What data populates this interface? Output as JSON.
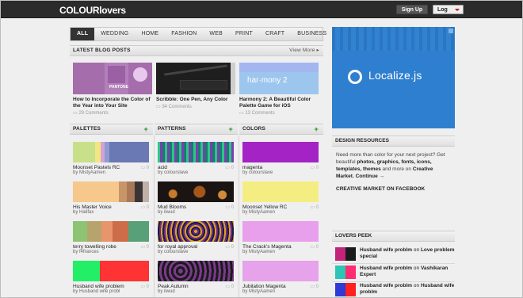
{
  "header": {
    "logo": "COLOURlovers",
    "signup_label": "Sign Up",
    "login_label": "Log"
  },
  "nav": {
    "items": [
      "ALL",
      "WEDDING",
      "HOME",
      "FASHION",
      "WEB",
      "PRINT",
      "CRAFT",
      "BUSINESS"
    ],
    "active": "ALL"
  },
  "blog": {
    "title": "LATEST BLOG POSTS",
    "view_more": "View More ▸",
    "posts": [
      {
        "title": "How to Incorporate the Color of the Year into Your Site",
        "meta": "29 Comments",
        "thumb_text": "PANTONE"
      },
      {
        "title": "Scribble: One Pen, Any Color",
        "meta": "34 Comments",
        "thumb_text": ""
      },
      {
        "title": "Harmony 2: A Beautiful Color Palette Game for iOS",
        "meta": "13 Comments",
        "thumb_text": "har·mony 2"
      }
    ]
  },
  "palettes": {
    "title": "PALETTES",
    "plus": "+",
    "items": [
      {
        "name": "Moonset Pastels RC",
        "by": "by MistyAamen",
        "count": "0",
        "colors": [
          "#c8e08a",
          "#f2e680",
          "#d8a0d8",
          "#8c9cd0",
          "#6a78b4"
        ],
        "widths": [
          28,
          7,
          5,
          6,
          50
        ]
      },
      {
        "name": "His Master Voice",
        "by": "by Halifax",
        "count": "0",
        "colors": [
          "#f6c88c",
          "#c89468",
          "#a87858",
          "#3c3434",
          "#c0b0a8"
        ],
        "widths": [
          58,
          10,
          10,
          10,
          8
        ]
      },
      {
        "name": "terry towelling robe",
        "by": "by f4frances",
        "count": "0",
        "colors": [
          "#8cc474",
          "#b6a46c",
          "#e8946c",
          "#cc6c48",
          "#58a078"
        ],
        "widths": [
          18,
          18,
          14,
          20,
          26
        ]
      },
      {
        "name": "Husband wife problem",
        "by": "by Husband wife probl",
        "count": "0",
        "colors": [
          "#22ee66",
          "#ff3333"
        ],
        "widths": [
          34,
          62
        ]
      }
    ]
  },
  "patterns": {
    "title": "PATTERNS",
    "plus": "+",
    "items": [
      {
        "name": "acid",
        "by": "by colourslave",
        "count": "0"
      },
      {
        "name": "Mud Blooms",
        "by": "by ilwud",
        "count": "0"
      },
      {
        "name": "for royal approval",
        "by": "by colourslave",
        "count": "0"
      },
      {
        "name": "Peak Autumn",
        "by": "by ilwud",
        "count": "0"
      }
    ]
  },
  "colors": {
    "title": "COLORS",
    "plus": "+",
    "items": [
      {
        "name": "magenta",
        "by": "by colourslave",
        "count": "0",
        "hex": "#a323c4"
      },
      {
        "name": "Moonset Yellow RC",
        "by": "by MistyAamen",
        "count": "0",
        "hex": "#f4ee82"
      },
      {
        "name": "The Crack's Magenta",
        "by": "by MistyAamen",
        "count": "0",
        "hex": "#e8a0ec"
      },
      {
        "name": "Jubilation Magenta",
        "by": "by MistyAamen",
        "count": "0",
        "hex": "#e6a2ea"
      }
    ]
  },
  "ad": {
    "text": "Localize.js"
  },
  "design_resources": {
    "title": "DESIGN RESOURCES",
    "text_1": "Need more than color for your next project? Get beautiful",
    "text_2": "photos, graphics, fonts, icons, templates, themes",
    "text_3": "and more on",
    "link_1": "Creative Market.",
    "link_2": "Continue →",
    "facebook": "CREATIVE MARKET ON FACEBOOK"
  },
  "lovers_peek": {
    "title": "LOVERS PEEK",
    "items": [
      {
        "who": "Husband wife problm",
        "on": "on",
        "what": "Love problem special",
        "colors": [
          "#c4237a",
          "#1a1a1a"
        ]
      },
      {
        "who": "Husband wife problm",
        "on": "on",
        "what": "Vashikaran Expert",
        "colors": [
          "#2ec4b6",
          "#ff2d6f"
        ]
      },
      {
        "who": "Husband wife problm",
        "on": "on",
        "what": "Husband wife problm",
        "colors": [
          "#2e3bd6",
          "#ff2020"
        ]
      }
    ]
  }
}
